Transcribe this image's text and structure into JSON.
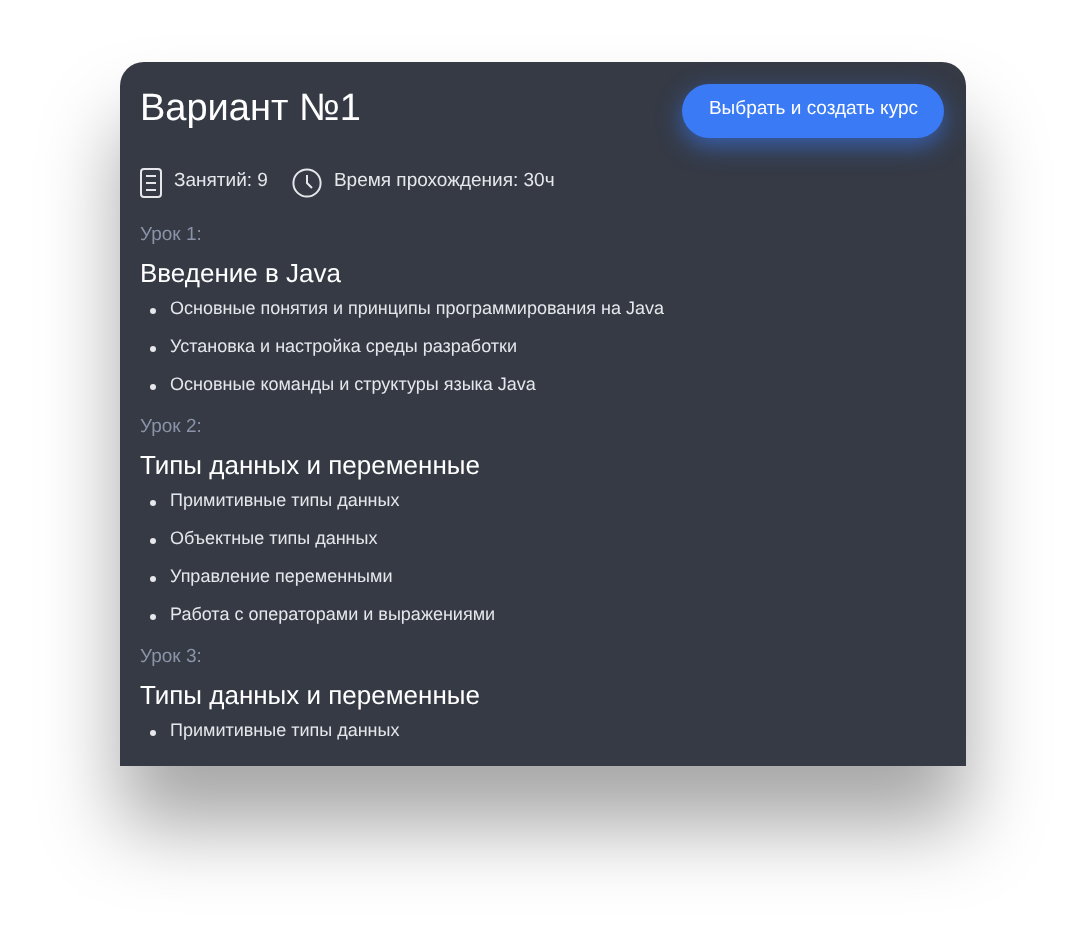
{
  "title": "Вариант №1",
  "action_button": "Выбрать и создать курс",
  "meta": [
    {
      "kind": "lessons",
      "text": "Занятий: 9"
    },
    {
      "kind": "duration",
      "text": "Время прохождения: 30ч"
    }
  ],
  "lessons": [
    {
      "label": "Урок 1:",
      "title": "Введение в Java",
      "topics": [
        "Основные понятия и принципы программирования на Java",
        "Установка и настройка среды разработки",
        "Основные команды и структуры языка Java"
      ]
    },
    {
      "label": "Урок 2:",
      "title": "Типы данных и переменные",
      "topics": [
        "Примитивные типы данных",
        "Объектные типы данных",
        "Управление переменными",
        "Работа с операторами и выражениями"
      ]
    },
    {
      "label": "Урок 3:",
      "title": "Типы данных и переменные",
      "topics": [
        "Примитивные типы данных"
      ]
    }
  ]
}
